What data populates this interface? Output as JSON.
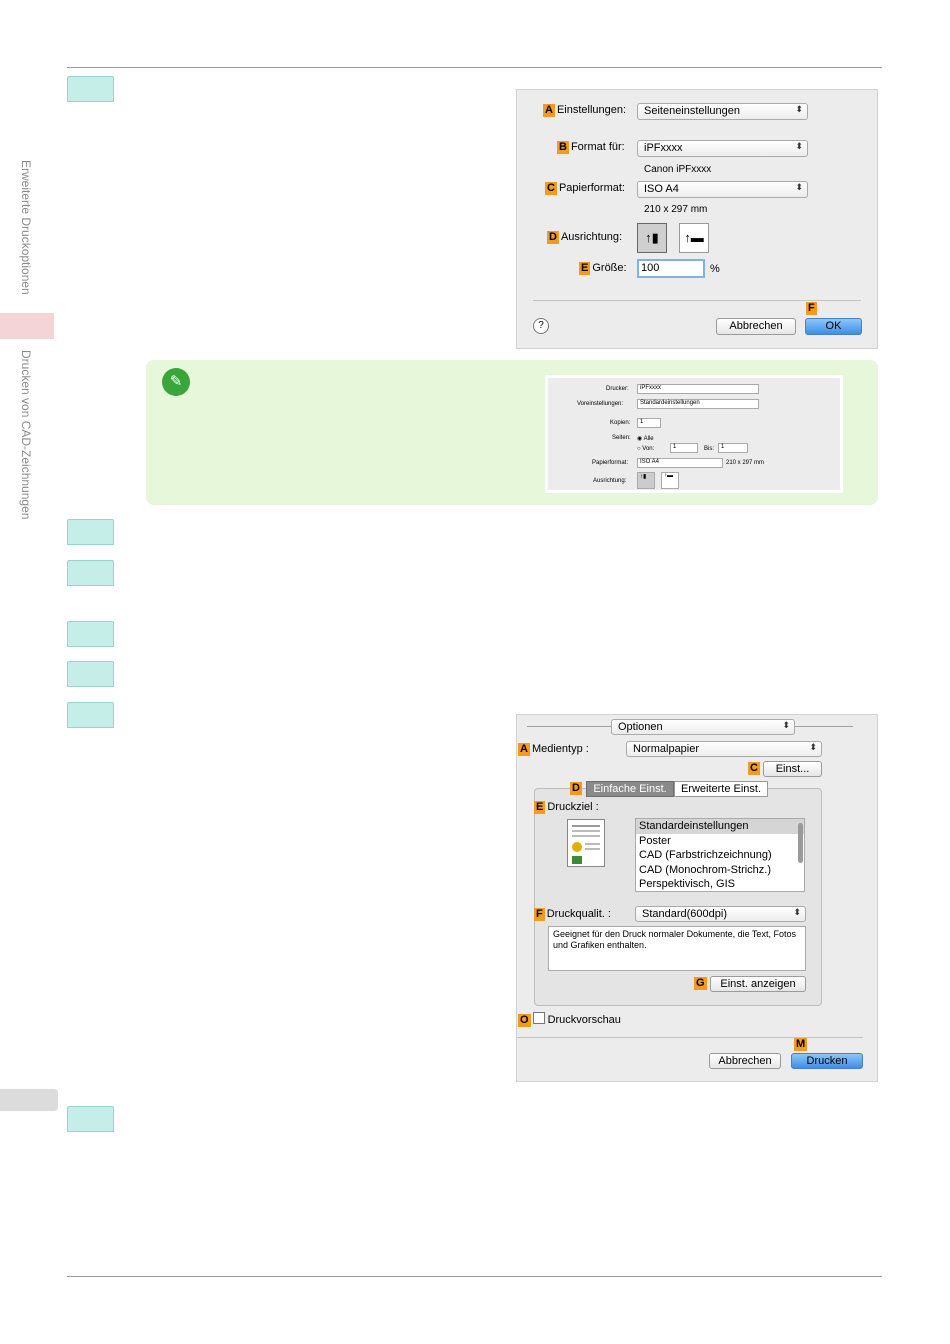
{
  "sidebar": {
    "section_1": "Erweiterte Druckoptionen",
    "section_2": "Drucken von CAD-Zeichnungen"
  },
  "page_setup_dialog": {
    "settings_key": "A",
    "settings_label": "Einstellungen:",
    "settings_value": "Seiteneinstellungen",
    "format_key": "B",
    "format_label": "Format für:",
    "format_value": "iPFxxxx",
    "format_sub": "Canon iPFxxxx",
    "paper_key": "C",
    "paper_label": "Papierformat:",
    "paper_value": "ISO A4",
    "paper_sub": "210 x 297 mm",
    "orient_key": "D",
    "orient_label": "Ausrichtung:",
    "size_key": "E",
    "size_label": "Größe:",
    "size_value": "100",
    "size_unit": "%",
    "help": "?",
    "cancel": "Abbrechen",
    "ok_key": "F",
    "ok": "OK"
  },
  "note_dialog": {
    "printer_label": "Drucker:",
    "printer_value": "iPFxxxx",
    "presets_label": "Voreinstellungen:",
    "presets_value": "Standardeinstellungen",
    "copies_label": "Kopien:",
    "copies_value": "1",
    "pages_label": "Seiten:",
    "pages_all": "Alle",
    "pages_from_label": "Von:",
    "pages_from_value": "1",
    "pages_to_label": "Bis:",
    "pages_to_value": "1",
    "paper_label": "Papierformat:",
    "paper_value": "ISO A4",
    "paper_sub": "210 x 297 mm",
    "orient_label": "Ausrichtung:"
  },
  "print_dialog": {
    "options_value": "Optionen",
    "media_key": "A",
    "media_label": "Medientyp :",
    "media_value": "Normalpapier",
    "settings_key": "C",
    "settings_button": "Einst...",
    "tabs_key": "D",
    "tab_basic": "Einfache Einst.",
    "tab_advanced": "Erweiterte Einst.",
    "target_key": "E",
    "target_label": "Druckziel :",
    "target_items": [
      "Standardeinstellungen",
      "Poster",
      "CAD (Farbstrichzeichnung)",
      "CAD (Monochrom-Strichz.)",
      "Perspektivisch, GIS"
    ],
    "quality_key": "F",
    "quality_label": "Druckqualit. :",
    "quality_value": "Standard(600dpi)",
    "description": "Geeignet für den Druck normaler Dokumente, die Text, Fotos und Grafiken enthalten.",
    "show_key": "G",
    "show_button": "Einst. anzeigen",
    "preview_key": "O",
    "preview_label": "Druckvorschau",
    "cancel": "Abbrechen",
    "print_key": "M",
    "print": "Drucken"
  }
}
